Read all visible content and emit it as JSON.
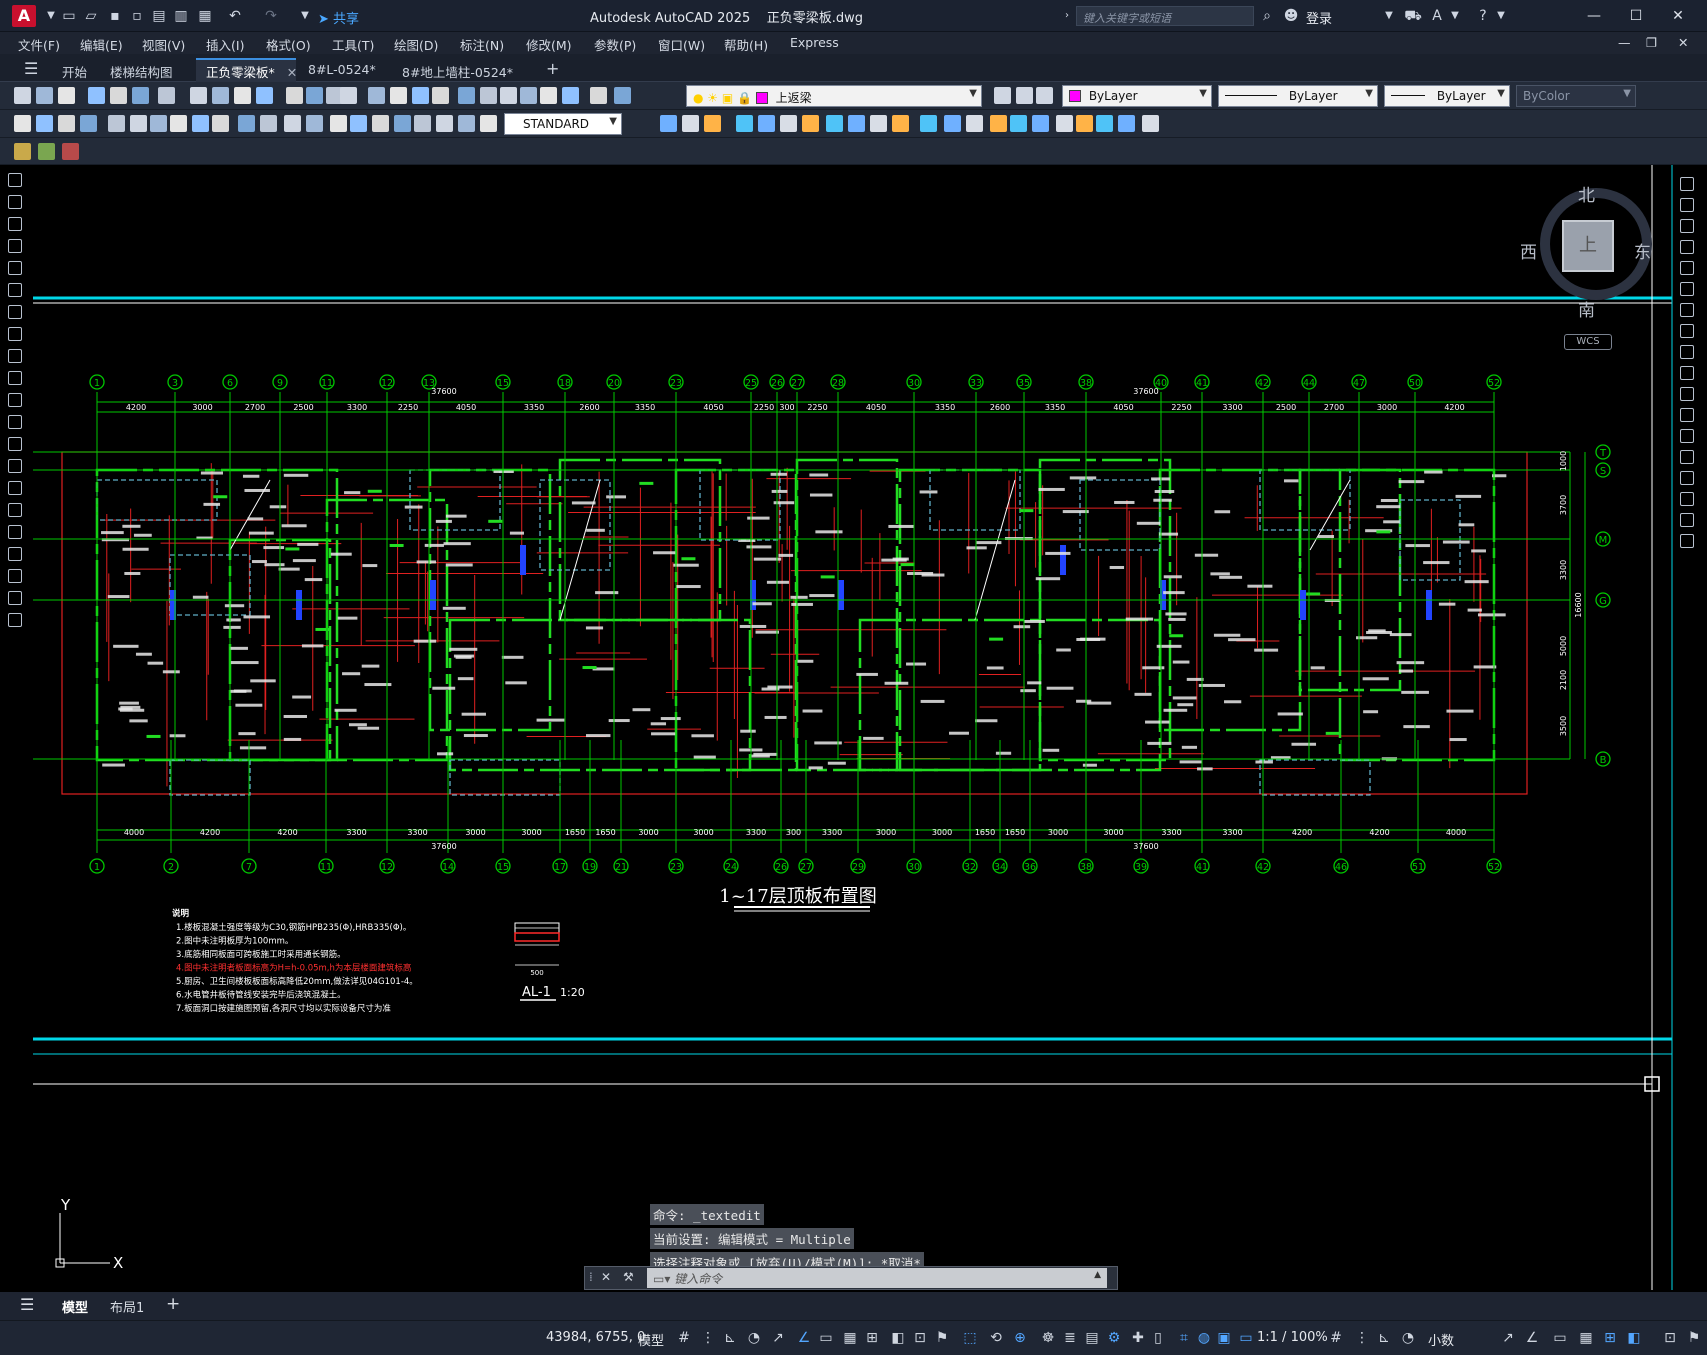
{
  "app": {
    "title": "Autodesk AutoCAD 2025",
    "document": "正负零梁板.dwg",
    "logo_letter": "A",
    "share_label": "共享",
    "search_placeholder": "键入关键字或短语",
    "login_label": "登录"
  },
  "menu": [
    "文件(F)",
    "编辑(E)",
    "视图(V)",
    "插入(I)",
    "格式(O)",
    "工具(T)",
    "绘图(D)",
    "标注(N)",
    "修改(M)",
    "参数(P)",
    "窗口(W)",
    "帮助(H)",
    "Express"
  ],
  "file_tabs": [
    {
      "label": "开始",
      "active": false
    },
    {
      "label": "楼梯结构图",
      "active": false
    },
    {
      "label": "正负零梁板*",
      "active": true
    },
    {
      "label": "8#L-0524*",
      "active": false
    },
    {
      "label": "8#地上墙柱-0524*",
      "active": false
    }
  ],
  "properties": {
    "layer": "上返梁",
    "layer_color": "#ff00ff",
    "color": "ByLayer",
    "linetype": "ByLayer",
    "lineweight": "ByLayer",
    "plotstyle": "ByColor",
    "text_style": "STANDARD"
  },
  "viewcube": {
    "north": "北",
    "south": "南",
    "east": "东",
    "west": "西",
    "top": "上",
    "wcs": "WCS"
  },
  "drawing": {
    "title": "1~17层顶板布置图",
    "axis_top": [
      "1",
      "3",
      "6",
      "9",
      "11",
      "12",
      "13",
      "15",
      "18",
      "20",
      "23",
      "25",
      "26",
      "27",
      "28",
      "30",
      "33",
      "35",
      "38",
      "40",
      "41",
      "42",
      "44",
      "47",
      "50",
      "52"
    ],
    "axis_bottom": [
      "1",
      "2",
      "7",
      "11",
      "12",
      "14",
      "15",
      "17",
      "19",
      "21",
      "23",
      "24",
      "26",
      "27",
      "29",
      "30",
      "32",
      "34",
      "36",
      "38",
      "39",
      "41",
      "42",
      "46",
      "51",
      "52"
    ],
    "axis_right": [
      "T",
      "S",
      "M",
      "G",
      "B"
    ],
    "dims_top": [
      "4200",
      "3000",
      "2700",
      "2500",
      "3300",
      "2250",
      "4050",
      "3350",
      "2600",
      "3350",
      "4050",
      "2250",
      "300",
      "2250",
      "4050",
      "3350",
      "2600",
      "3350",
      "4050",
      "2250",
      "3300",
      "2500",
      "2700",
      "3000",
      "4200"
    ],
    "dims_bottom": [
      "4000",
      "4200",
      "4200",
      "3300",
      "3300",
      "3000",
      "3000",
      "1650",
      "1650",
      "3000",
      "3000",
      "3300",
      "300",
      "3300",
      "3000",
      "3000",
      "1650",
      "1650",
      "3000",
      "3000",
      "3300",
      "3300",
      "4200",
      "4200",
      "4000"
    ],
    "total_left": "37600",
    "total_right": "37600",
    "total_height": "16600",
    "dims_right": [
      "1000",
      "3700",
      "3300",
      "5000",
      "2100",
      "3500"
    ],
    "notes_title": "说明",
    "notes": [
      "1.楼板混凝土强度等级为C30,钢筋HPB235(Φ),HRB335(Φ)。",
      "2.图中未注明板厚为100mm。",
      "3.底筋相同板面可跨板施工时采用通长钢筋。",
      "4.图中未注明者板面标高为H=h-0.05m,h为本层楼面建筑标高",
      "5.厨房、卫生间楼板板面标高降低20mm,做法详见04G101-4。",
      "6.水电管井板待管线安装完毕后浇筑混凝土。",
      "7.板面洞口按建施图预留,各洞尺寸均以实际设备尺寸为准"
    ],
    "detail_label": "AL-1",
    "detail_scale": "1:20",
    "detail_dim": "500",
    "ucs_x": "X",
    "ucs_y": "Y"
  },
  "command": {
    "history": [
      "命令: _textedit",
      "当前设置: 编辑模式 = Multiple",
      "选择注释对象或 [放弃(U)/模式(M)]: *取消*"
    ],
    "placeholder": "键入命令"
  },
  "layout_tabs": [
    {
      "label": "模型",
      "active": true
    },
    {
      "label": "布局1",
      "active": false
    }
  ],
  "status": {
    "coordinates": "43984, 6755, 0",
    "model_label": "模型",
    "scale": "1:1 / 100%",
    "units": "小数"
  }
}
